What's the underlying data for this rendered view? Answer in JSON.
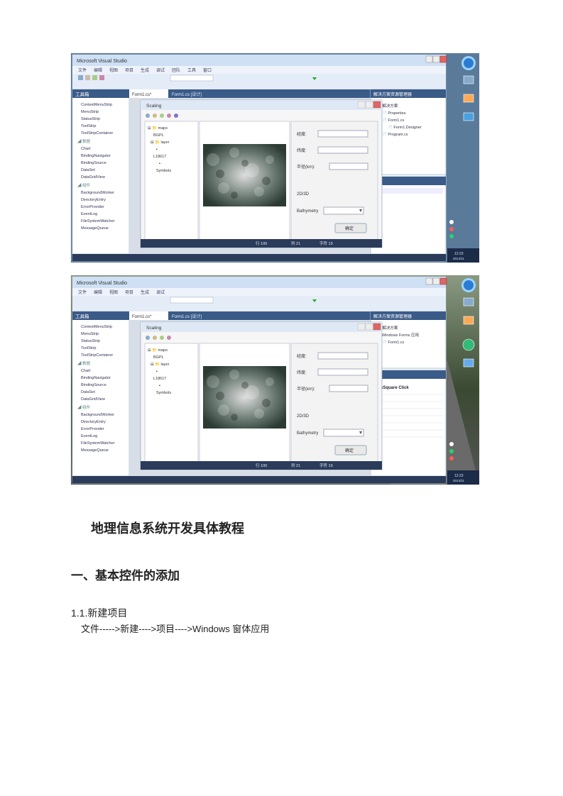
{
  "shared": {
    "vs_title_hint": "Microsoft Visual Studio",
    "tab1": "Form1.cs*",
    "tab2": "Form1.cs [设计]",
    "toolbox_label": "工具箱",
    "solution_label": "解决方案资源管理器",
    "tree": {
      "root": "解决方案",
      "proj": "BGPL",
      "items": [
        "Properties",
        "L18617",
        "Form1.cs"
      ]
    },
    "inner_window_title": "Scaling",
    "form_labels": [
      "经度:",
      "纬度:",
      "半径(km):"
    ],
    "form_values": [
      "",
      "",
      ""
    ],
    "chart_label": "2D/3D",
    "dropdown_label": "Bathymetry",
    "dropdown_value": "",
    "button_label": "确定",
    "statusbar": {
      "row": "行 100",
      "col": "列 21",
      "ch": "字符 19"
    }
  },
  "shot2_extra": {
    "event_label": "btnSquare Click",
    "solution_item": "Windows Forms 应用"
  },
  "doc": {
    "title": "地理信息系统开发具体教程",
    "section": "一、基本控件的添加",
    "step_num": "1.1.新建项目",
    "step_path": "文件----->新建---->项目---->Windows 窗体应用"
  },
  "taskbar_time": "12:23",
  "taskbar_date": "2014/11"
}
